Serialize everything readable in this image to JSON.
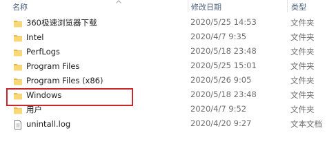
{
  "columns": {
    "name": "名称",
    "date": "修改日期",
    "type": "类型"
  },
  "files": [
    {
      "name": "360极速浏览器下载",
      "date": "2020/5/25 14:53",
      "type": "文件夹",
      "icon": "folder-icon"
    },
    {
      "name": "Intel",
      "date": "2020/4/7 9:35",
      "type": "文件夹",
      "icon": "folder-icon"
    },
    {
      "name": "PerfLogs",
      "date": "2020/5/18 23:48",
      "type": "文件夹",
      "icon": "folder-icon"
    },
    {
      "name": "Program Files",
      "date": "2020/5/25 15:01",
      "type": "文件夹",
      "icon": "folder-icon"
    },
    {
      "name": "Program Files (x86)",
      "date": "2020/5/26 9:05",
      "type": "文件夹",
      "icon": "folder-icon"
    },
    {
      "name": "Windows",
      "date": "2020/5/18 23:48",
      "type": "文件夹",
      "icon": "folder-icon"
    },
    {
      "name": "用户",
      "date": "2020/4/7 9:52",
      "type": "文件夹",
      "icon": "folder-icon"
    },
    {
      "name": "unintall.log",
      "date": "2020/4/20 9:27",
      "type": "文本文档",
      "icon": "text-file-icon"
    }
  ],
  "highlighted_item": "Windows",
  "colors": {
    "folder": "#f8d775",
    "highlight_border": "#c8262a",
    "header_text": "#4c607a"
  }
}
